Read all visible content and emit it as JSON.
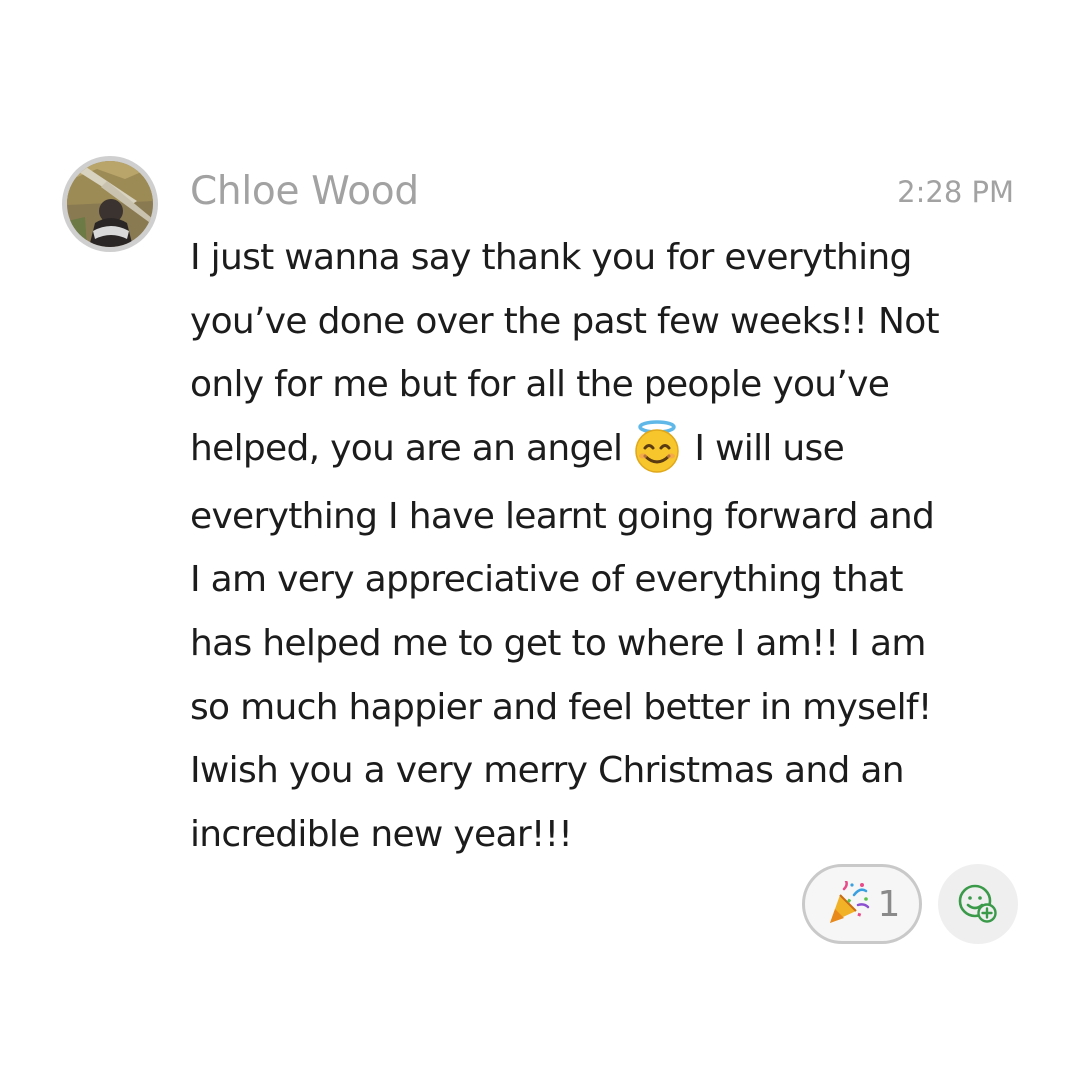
{
  "message": {
    "sender": "Chloe Wood",
    "time": "2:28 PM",
    "avatar_icon": "user-photo-avatar",
    "body_lines": [
      "I just wanna say thank you for everything",
      "you’ve done over the past few weeks!! Not",
      "only for me but for all the people you’ve",
      "helped, you are an angel",
      "I will use",
      "everything I have learnt going forward and",
      "I am very appreciative of everything that",
      "has helped me to get to where I am!! I am",
      "so much happier and feel better in myself!",
      "Iwish you a very merry Christmas and an",
      "incredible new year!!!"
    ],
    "inline_emoji": "smiling-face-with-halo-icon"
  },
  "reactions": [
    {
      "emoji": "party-popper-icon",
      "count": "1"
    }
  ],
  "add_reaction_icon": "add-reaction-icon",
  "colors": {
    "meta_text": "#a2a2a2",
    "body_text": "#1c1c1c",
    "add_reaction_green": "#3a9a4a",
    "pill_border": "#c9c9c9"
  }
}
